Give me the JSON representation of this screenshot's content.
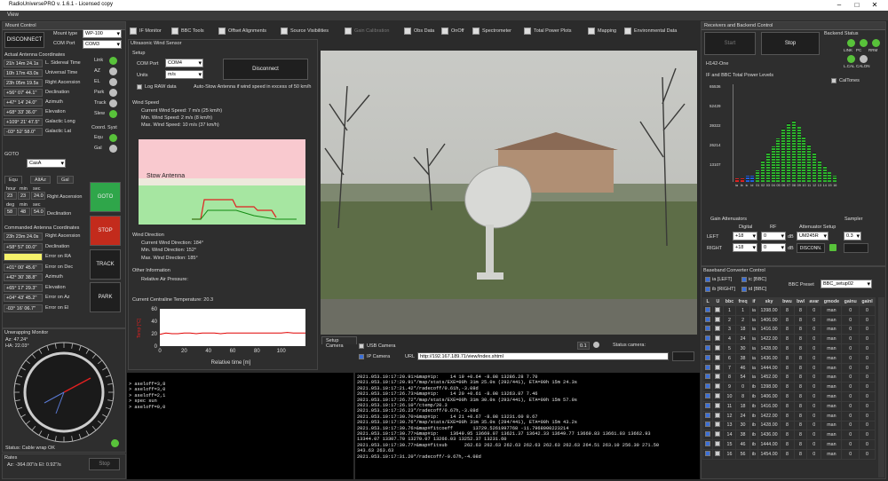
{
  "window": {
    "title": "RadioUniversePRO v. 1.6.1 - Licensed copy"
  },
  "menu": {
    "view": "View"
  },
  "toolbar": [
    {
      "label": "IF Monitor",
      "enabled": true
    },
    {
      "label": "BBC Tools",
      "enabled": true
    },
    {
      "label": "Offset Alignments",
      "enabled": true
    },
    {
      "label": "Source Visibilities",
      "enabled": true
    },
    {
      "label": "Gain Calibration",
      "enabled": false
    },
    {
      "label": "Obs Data",
      "enabled": true
    },
    {
      "label": "OnOff",
      "enabled": true
    },
    {
      "label": "Spectrometer",
      "enabled": true
    },
    {
      "label": "Total Power Plots",
      "enabled": true
    },
    {
      "label": "Mapping",
      "enabled": true
    },
    {
      "label": "Environmental Data",
      "enabled": true
    }
  ],
  "mount": {
    "header": "Mount Control",
    "disconnect": "DISCONNECT",
    "mount_type_label": "Mount type",
    "mount_type": "WP-100",
    "com_port_label": "COM Port",
    "com_port": "COM3",
    "actual_header": "Actual Antenna Coordinates",
    "actual": [
      {
        "value": "21h 14m 24.1s",
        "label": "L. Sidereal Time"
      },
      {
        "value": "10h 17m 43.0s",
        "label": "Universal Time"
      },
      {
        "value": "23h 05m 19.5s",
        "label": "Right Ascension"
      },
      {
        "value": "+56° 07' 44.1\"",
        "label": "Declination"
      },
      {
        "value": "+47° 14' 24.0\"",
        "label": "Azimuth"
      },
      {
        "value": "+68° 33' 36.0\"",
        "label": "Elevation"
      },
      {
        "value": "+109° 21' 47.5\"",
        "label": "Galactic Long"
      },
      {
        "value": "-03° 52' 58.0\"",
        "label": "Galactic Lat"
      }
    ],
    "status_leds": [
      {
        "label": "Link",
        "on": true
      },
      {
        "label": "AZ",
        "on": false
      },
      {
        "label": "EL",
        "on": false
      },
      {
        "label": "Park",
        "on": false
      },
      {
        "label": "Track",
        "on": false
      },
      {
        "label": "Slew",
        "on": true
      }
    ],
    "coord_syst_label": "Coord. Syst",
    "coord_leds": [
      {
        "label": "Equ",
        "on": true
      },
      {
        "label": "Gal",
        "on": false
      }
    ],
    "goto_header": "GOTO",
    "goto_target": "CasA",
    "tabs": [
      "Equ",
      "AltAz",
      "Gal"
    ],
    "hms_headers": [
      "hour",
      "min",
      "sec"
    ],
    "ra_values": [
      "23",
      "23",
      "24.0"
    ],
    "ra_label": "Right Ascension",
    "dms_headers": [
      "deg",
      "min",
      "sec"
    ],
    "dec_values": [
      "58",
      "48",
      "54.0"
    ],
    "dec_label": "Declination",
    "commanded_header": "Commanded Antenna Coordinates",
    "commanded": [
      {
        "value": "23h 23m 24.0s",
        "label": "Right Ascension"
      },
      {
        "value": "+58° 57' 00.0\"",
        "label": "Declination"
      },
      {
        "value": "",
        "label": "Error on RA"
      },
      {
        "value": "+01° 00' 45.6\"",
        "label": "Error on Dec"
      },
      {
        "value": "+42° 30' 38.8\"",
        "label": "Azimuth"
      },
      {
        "value": "+65° 17' 29.3\"",
        "label": "Elevation"
      },
      {
        "value": "+04° 43' 45.2\"",
        "label": "Error on Az"
      },
      {
        "value": "-03° 16' 06.7\"",
        "label": "Error on El"
      }
    ],
    "buttons": {
      "goto": "GOTO",
      "stop": "STOP",
      "track": "TRACK",
      "park": "PARK"
    },
    "unwrap_header": "Unwrapping Monitor",
    "unwrap_az": "Az: 47.24°",
    "unwrap_ha": "HA: 22.03°",
    "cable_status": "Status: Cable wrap OK",
    "rates_header": "Rates",
    "rates": "Az: -364.00\"/s    El: 0.92\"/s",
    "rates_btn": "Stop"
  },
  "wind": {
    "header": "Ultrasonic Wind Sensor",
    "setup": "Setup",
    "com_port_label": "COM Port",
    "com_port": "COM4",
    "units_label": "Units",
    "units": "m/s",
    "disconnect": "Disconnect",
    "log_raw": "Log RAW data",
    "auto_stow": "Auto-Stow Antenna if wind speed in excess of 50 km/h",
    "speed_header": "Wind Speed",
    "current_speed": "Current Wind Speed: 7 m/s (25 km/h)",
    "min_speed": "Min. Wind Speed: 2 m/s (8 km/h)",
    "max_speed": "Max. Wind Speed: 10 m/s (37 km/h)",
    "stow_label": "Stow Antenna",
    "direction_header": "Wind Direction",
    "current_dir": "Current Wind Direction: 184°",
    "min_dir": "Min. Wind Direction: 152°",
    "max_dir": "Max. Wind Direction: 185°",
    "other_header": "Other Information",
    "pressure": "Relative Air Pressure:",
    "temp_header": "Current Centraline Temperature: 20.3"
  },
  "chart_data": {
    "type": "line",
    "title": "",
    "xlabel": "Relative time [m]",
    "ylabel": "Temp [°C]",
    "xlim": [
      0,
      120
    ],
    "ylim": [
      0,
      60
    ],
    "x_ticks": [
      0,
      20,
      40,
      60,
      80,
      100
    ],
    "y_ticks": [
      0,
      20,
      40,
      60
    ],
    "series": [
      {
        "color": "#e00000",
        "values": [
          19,
          21,
          20,
          20,
          21,
          21,
          20,
          21,
          21,
          21,
          20,
          21,
          21,
          21,
          21,
          21,
          21,
          21,
          21,
          21,
          21,
          22,
          21,
          21,
          21
        ]
      }
    ]
  },
  "camera": {
    "tabs": [
      "Setup Camera",
      "USB Camera"
    ],
    "ip_camera": "IP Camera",
    "url_label": "URL",
    "url": "http://192.167.189.71/view/index.shtml",
    "status_label": "Status camera:",
    "value_box": "0.1"
  },
  "terminal_left": {
    "lines": [
      "> aseloff=3,8",
      "> aseloff=3,0",
      "> aseloff=2,1",
      "> spec sun",
      "> aseloff=0,0"
    ]
  },
  "terminal_right": {
    "lines": [
      "2021.053.10:17:20.91>&map#ip:    14 19 +0.64 -8.08 13286.28 7.70",
      "2021.053.10:17:20.91*/map/stats/EXE=00h 31m 25.0s (292/441), ETA=00h 15m 24.3s",
      "2021.053.10:17:21.42*/radecoff/0.61h,-3.08d",
      "2021.053.10:17:26.73>&map#ip:    14 20 +0.61 -8.08 13263.87 7.46",
      "2021.053.10:17:26.72*/map/stats/EXE=00h 31m 30.0s (293/441), ETA=00h 15m 57.0s",
      "2021.053.10:17:26.10*/ctemp/20.3",
      "2021.053.10:17:26.23*/radecoff/0.67h,-3.08d",
      "2021.053.10:17:30.70>&map#ip:    14 21 +0.67 -8.08 13231.60 8.67",
      "2021.053.10:17:30.76*/map/stats/EXE=00h 31m 35.0s (294/441), ETA=00h 15m 43.2s",
      "2021.053.10:17:30.76>&map#fitcoeff       13729.5261997768 -11.7968000223214",
      "2021.053.10:17:30.77>&map#ip:    13649.95 13669.07 13621.37 13642.33 13649.77 13669.83 13661.03 13662.93",
      "13344.07 13307.70 13270.07 13266.03 13252.37 13231.60",
      "2021.053.10:17:30.77>&map#fitsub      262.63 262.63 262.63 262.63 262.63 262.63 264.51 263.10 256.30 271.50",
      "343.63 263.63",
      "2021.053.10:17:31.20*/radecoff/-0.67h,-4.08d"
    ]
  },
  "receivers": {
    "header": "Receivers and Backend Control",
    "start_btn": "Start",
    "stop_btn": "Stop",
    "backend_status": "Backend Status",
    "backend_leds": [
      {
        "label": "LINK",
        "on": true
      },
      {
        "label": "PC",
        "on": true
      },
      {
        "label": "RRM",
        "on": true
      },
      {
        "label": "L.CAL",
        "on": true
      },
      {
        "label": "CALON",
        "on": false
      }
    ],
    "receiver_name": "H142-One",
    "power_header": "IF and BBC Total Power Levels",
    "cal_tones": "CalTones",
    "y_ticks": [
      "65536",
      "52429",
      "39322",
      "26214",
      "13107"
    ],
    "bars": [
      {
        "label": "ia",
        "value": 0.04,
        "color": "#e02020"
      },
      {
        "label": "ib",
        "value": 0.04,
        "color": "#e02020"
      },
      {
        "label": "ic",
        "value": 0.06,
        "color": "#2060e0"
      },
      {
        "label": "id",
        "value": 0.06,
        "color": "#2060e0"
      },
      {
        "label": "01",
        "value": 0.12,
        "color": "#2db52d"
      },
      {
        "label": "02",
        "value": 0.22,
        "color": "#2db52d"
      },
      {
        "label": "03",
        "value": 0.3,
        "color": "#2db52d"
      },
      {
        "label": "04",
        "value": 0.36,
        "color": "#2db52d"
      },
      {
        "label": "05",
        "value": 0.45,
        "color": "#2db52d"
      },
      {
        "label": "06",
        "value": 0.55,
        "color": "#2db52d"
      },
      {
        "label": "07",
        "value": 0.6,
        "color": "#2db52d"
      },
      {
        "label": "08",
        "value": 0.63,
        "color": "#2db52d"
      },
      {
        "label": "09",
        "value": 0.56,
        "color": "#2db52d"
      },
      {
        "label": "10",
        "value": 0.46,
        "color": "#2db52d"
      },
      {
        "label": "11",
        "value": 0.38,
        "color": "#2db52d"
      },
      {
        "label": "12",
        "value": 0.3,
        "color": "#2db52d"
      },
      {
        "label": "13",
        "value": 0.22,
        "color": "#2db52d"
      },
      {
        "label": "14",
        "value": 0.16,
        "color": "#2db52d"
      },
      {
        "label": "15",
        "value": 0.1,
        "color": "#2db52d"
      },
      {
        "label": "16",
        "value": 0.06,
        "color": "#2db52d"
      }
    ],
    "gain_header": "Gain Attenuators",
    "digital_label": "Digital",
    "rf_label": "RF",
    "atten_setup": "Attenuator Setup",
    "left_label": "LEFT",
    "right_label": "RIGHT",
    "left_digital": "+18",
    "right_digital": "+18",
    "left_rf": "0",
    "right_rf": "0",
    "db": "dB",
    "atten_model": "UM245R",
    "atten_btn": "DISCONN.",
    "sampler_header": "Sampler",
    "sampler_value": "0.3",
    "bbc_header": "Baseband Converter Control",
    "bbc_checks": [
      "ia [LEFT]",
      "ic [BBC]",
      "ib [RIGHT]",
      "id [BBC]"
    ],
    "bbc_preset_label": "BBC Preset",
    "bbc_preset": "BBC_setup02",
    "table_headers": [
      "L",
      "U",
      "bbc",
      "freq",
      "if",
      "sky",
      "bwu",
      "bwl",
      "avar",
      "gmode",
      "gainu",
      "gainl"
    ],
    "table_rows": [
      [
        "1",
        "ia",
        "1398.00",
        "8",
        "8",
        "0",
        "man",
        "0",
        "0"
      ],
      [
        "2",
        "ia",
        "1406.00",
        "8",
        "8",
        "0",
        "man",
        "0",
        "0"
      ],
      [
        "18",
        "ia",
        "1416.00",
        "8",
        "8",
        "0",
        "man",
        "0",
        "0"
      ],
      [
        "24",
        "ia",
        "1422.00",
        "8",
        "8",
        "0",
        "man",
        "0",
        "0"
      ],
      [
        "30",
        "ia",
        "1428.00",
        "8",
        "8",
        "0",
        "man",
        "0",
        "0"
      ],
      [
        "38",
        "ia",
        "1436.00",
        "8",
        "8",
        "0",
        "man",
        "0",
        "0"
      ],
      [
        "46",
        "ia",
        "1444.00",
        "8",
        "8",
        "0",
        "man",
        "0",
        "0"
      ],
      [
        "54",
        "ia",
        "1452.00",
        "8",
        "8",
        "0",
        "man",
        "0",
        "0"
      ],
      [
        "0",
        "ib",
        "1398.00",
        "8",
        "8",
        "0",
        "man",
        "0",
        "0"
      ],
      [
        "8",
        "ib",
        "1406.00",
        "8",
        "8",
        "0",
        "man",
        "0",
        "0"
      ],
      [
        "18",
        "ib",
        "1416.00",
        "8",
        "8",
        "0",
        "man",
        "0",
        "0"
      ],
      [
        "24",
        "ib",
        "1422.00",
        "8",
        "8",
        "0",
        "man",
        "0",
        "0"
      ],
      [
        "30",
        "ib",
        "1428.00",
        "8",
        "8",
        "0",
        "man",
        "0",
        "0"
      ],
      [
        "38",
        "ib",
        "1436.00",
        "8",
        "8",
        "0",
        "man",
        "0",
        "0"
      ],
      [
        "46",
        "ib",
        "1444.00",
        "8",
        "8",
        "0",
        "man",
        "0",
        "0"
      ],
      [
        "56",
        "ib",
        "1454.00",
        "8",
        "8",
        "0",
        "man",
        "0",
        "0"
      ]
    ]
  }
}
